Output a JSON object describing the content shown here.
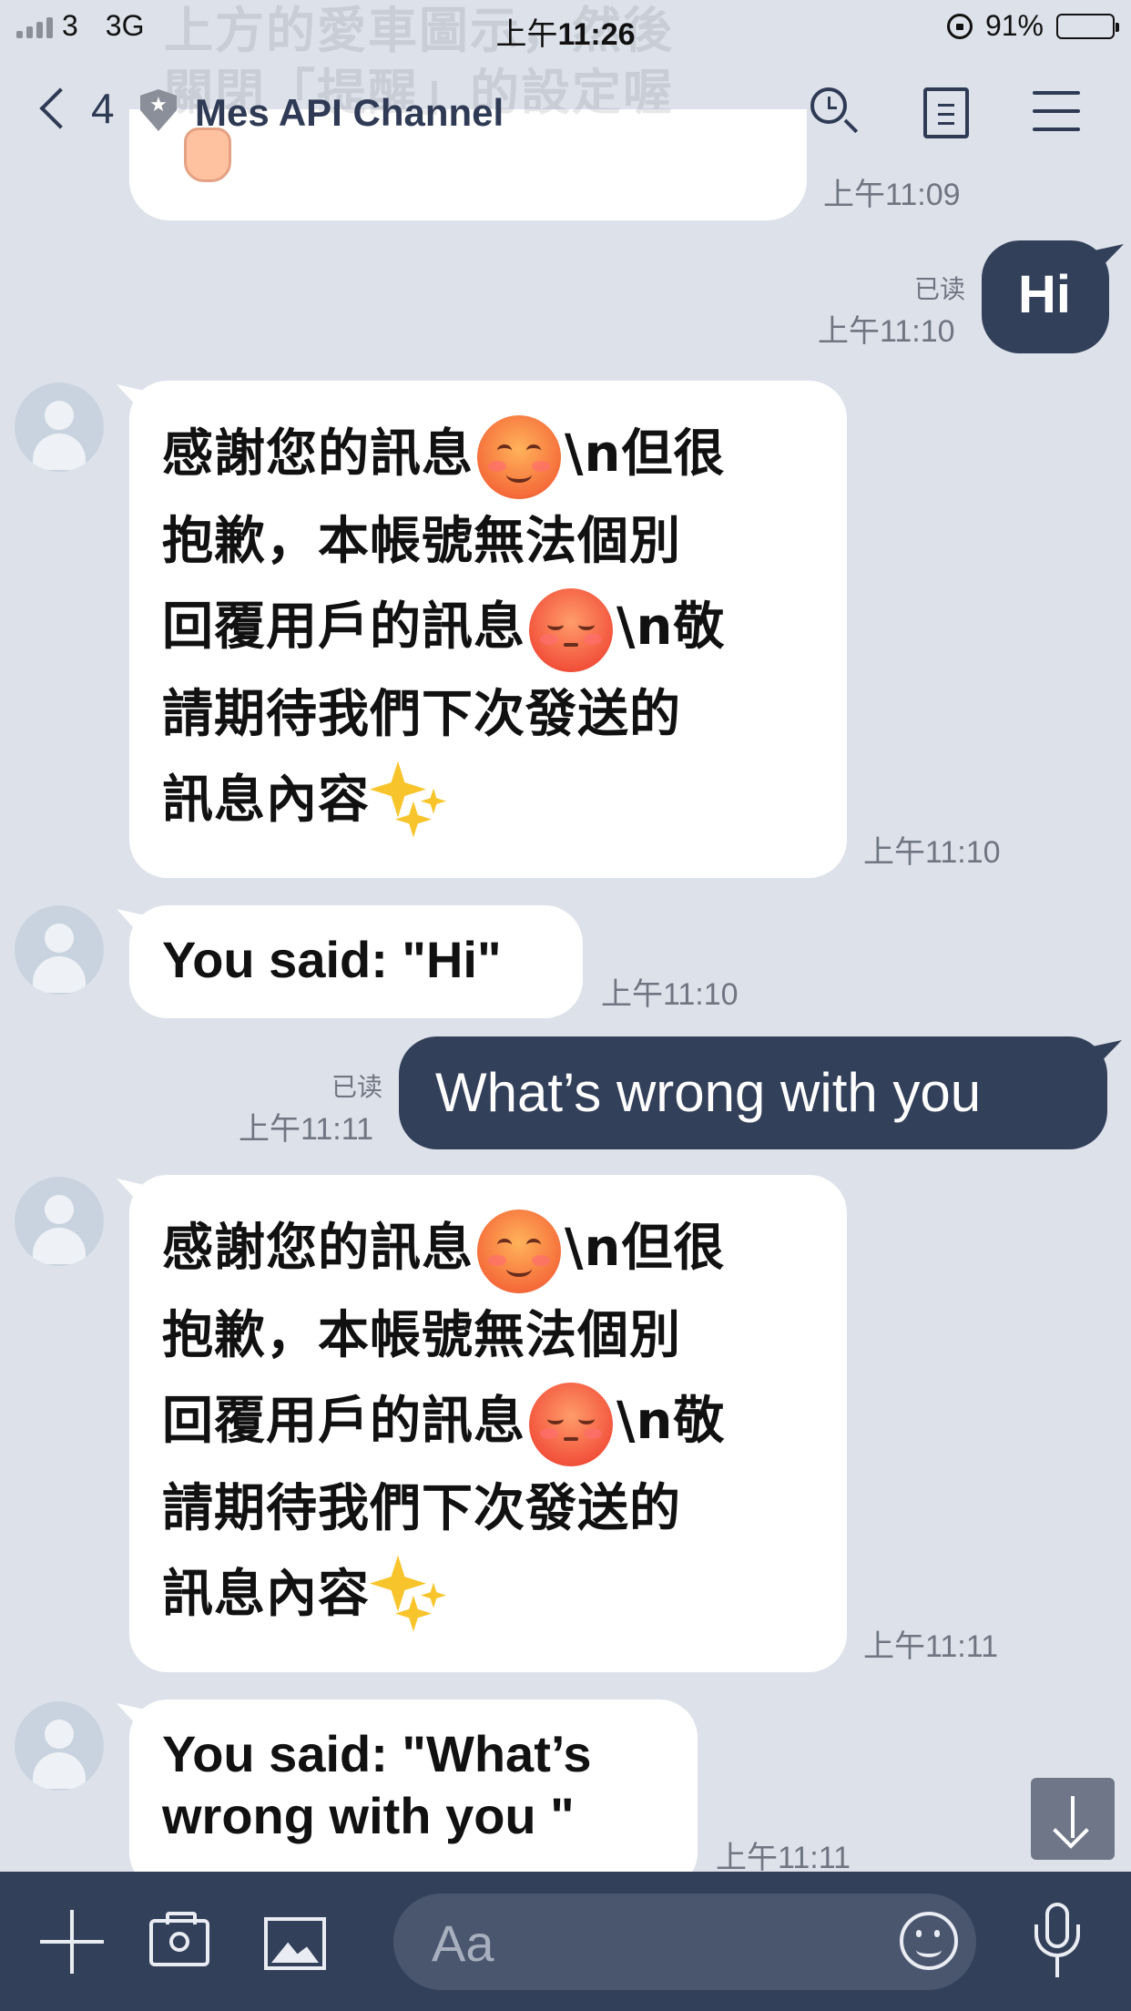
{
  "status_bar": {
    "carrier": "3",
    "network": "3G",
    "time_prefix": "上午",
    "time": "11:26",
    "battery": "91%",
    "battery_level": 0.91
  },
  "header": {
    "ghost_line1": "上方的愛車圖示，然後",
    "ghost_line2": "關閉「提醒」的設定喔",
    "back_count": "4",
    "channel_name": "Mes API Channel"
  },
  "messages": {
    "m0_time": "上午11:09",
    "m1_text": "Hi",
    "m1_read": "已读",
    "m1_time": "上午11:10",
    "m2_text_a": "感謝您的訊息",
    "m2_text_b": "\\n但很",
    "m2_text_c": "抱歉，本帳號無法個別",
    "m2_text_d": "回覆用戶的訊息",
    "m2_text_e": "\\n敬",
    "m2_text_f": "請期待我們下次發送的",
    "m2_text_g": "訊息內容",
    "m2_time": "上午11:10",
    "m3_text": "You said: \"Hi\"",
    "m3_time": "上午11:10",
    "m4_text": "What’s wrong with you",
    "m4_read": "已读",
    "m4_time": "上午11:11",
    "m5_text_a": "感謝您的訊息",
    "m5_text_b": "\\n但很",
    "m5_text_c": "抱歉，本帳號無法個別",
    "m5_text_d": "回覆用戶的訊息",
    "m5_text_e": "\\n敬",
    "m5_text_f": "請期待我們下次發送的",
    "m5_text_g": "訊息內容",
    "m5_time": "上午11:11",
    "m6_text": "You said: \"What’s\nwrong with you \"",
    "m6_time": "上午11:11"
  },
  "input": {
    "placeholder": "Aa"
  },
  "colors": {
    "background": "#dde2ea",
    "outgoing_bubble": "#33405a",
    "incoming_bubble": "#ffffff",
    "toolbar": "#33405a"
  },
  "icons": [
    "back-chevron-icon",
    "shield-icon",
    "search-icon",
    "notes-icon",
    "menu-icon",
    "plus-icon",
    "camera-icon",
    "image-icon",
    "emoji-icon",
    "microphone-icon",
    "scroll-down-icon"
  ]
}
